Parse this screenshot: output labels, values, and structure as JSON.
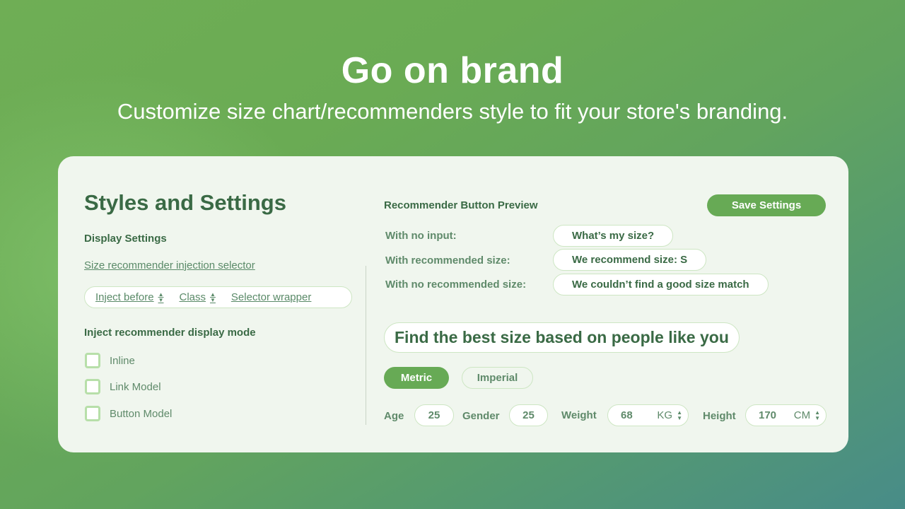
{
  "hero": {
    "title": "Go on brand",
    "subtitle": "Customize size chart/recommenders style to fit your store's branding."
  },
  "colors": {
    "brand_green": "#67aa55",
    "text_dark_green": "#3a6a45",
    "card_bg": "#f0f6ee",
    "bg_top": "#6aab54",
    "bg_bottom_right": "#488c88"
  },
  "left": {
    "title": "Styles and Settings",
    "display_settings": "Display Settings",
    "injection_selector_link": "Size recommender injection selector",
    "selector": {
      "position": "Inject before",
      "type": "Class",
      "value": "Selector wrapper",
      "stepper_icon": "up-down-arrows"
    },
    "display_mode_heading": "Inject recommender display mode",
    "modes": [
      {
        "label": "Inline",
        "checked": false
      },
      {
        "label": "Link Model",
        "checked": false
      },
      {
        "label": "Button Model",
        "checked": false
      }
    ]
  },
  "right": {
    "preview_heading": "Recommender Button Preview",
    "save_button": "Save Settings",
    "previews": [
      {
        "label": "With no input:",
        "button": "What’s my size?"
      },
      {
        "label": "With recommended size:",
        "button": "We recommend size: S"
      },
      {
        "label": "With no recommended size:",
        "button": "We couldn’t find a good size match"
      }
    ],
    "find_title": "Find the best size based on people like you",
    "units": {
      "metric": "Metric",
      "imperial": "Imperial",
      "selected": "Metric"
    },
    "fields": {
      "age": {
        "label": "Age",
        "value": "25"
      },
      "gender": {
        "label": "Gender",
        "value": "25"
      },
      "weight": {
        "label": "Weight",
        "value": "68",
        "unit": "KG"
      },
      "height": {
        "label": "Height",
        "value": "170",
        "unit": "CM"
      }
    }
  }
}
